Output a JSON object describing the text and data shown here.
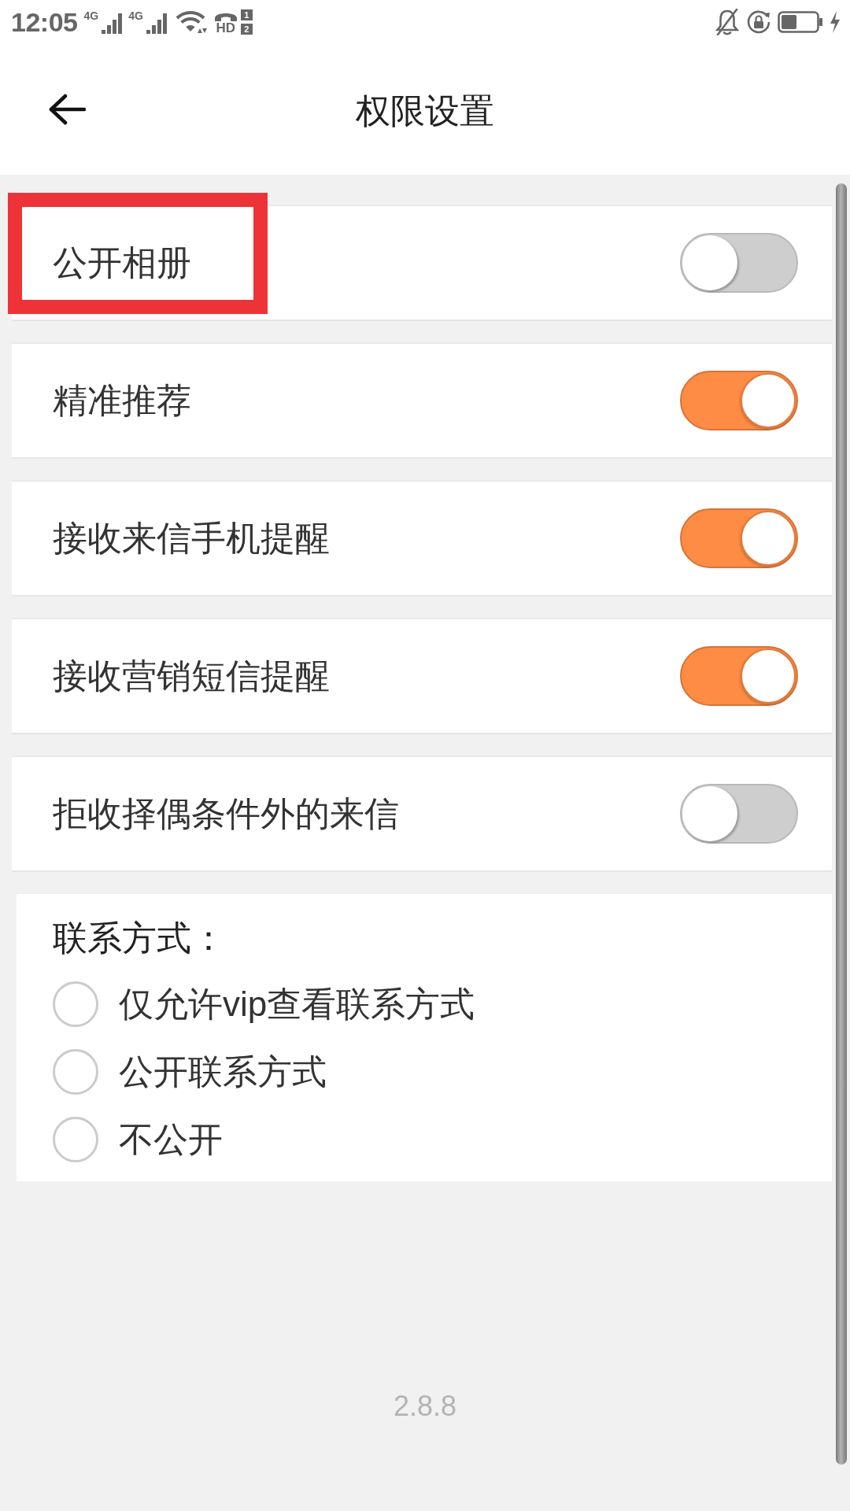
{
  "status_bar": {
    "time": "12:05",
    "signals": [
      {
        "network": "4G"
      },
      {
        "network": "4G"
      }
    ],
    "hd_indicator": {
      "label": "HD",
      "slots": [
        "1",
        "2"
      ]
    }
  },
  "header": {
    "title": "权限设置"
  },
  "settings": [
    {
      "label": "公开相册",
      "on": false,
      "highlighted": true
    },
    {
      "label": "精准推荐",
      "on": true,
      "highlighted": false
    },
    {
      "label": "接收来信手机提醒",
      "on": true,
      "highlighted": false
    },
    {
      "label": "接收营销短信提醒",
      "on": true,
      "highlighted": false
    },
    {
      "label": "拒收择偶条件外的来信",
      "on": false,
      "highlighted": false
    }
  ],
  "contact": {
    "heading": "联系方式：",
    "options": [
      {
        "label": "仅允许vip查看联系方式",
        "selected": false
      },
      {
        "label": "公开联系方式",
        "selected": false
      },
      {
        "label": "不公开",
        "selected": false
      }
    ]
  },
  "version": "2.8.8"
}
